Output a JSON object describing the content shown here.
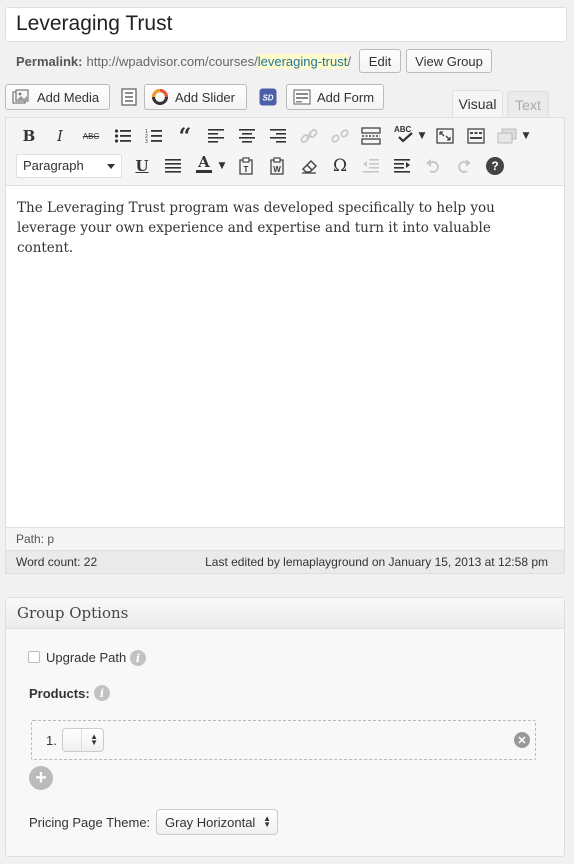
{
  "post": {
    "title": "Leveraging Trust",
    "permalink_label": "Permalink:",
    "permalink_base": "http://wpadvisor.com/courses/",
    "permalink_slug": "leveraging-trust",
    "permalink_trail": "/",
    "edit_label": "Edit",
    "view_group_label": "View Group"
  },
  "media_buttons": {
    "add_media": "Add Media",
    "add_slider": "Add Slider",
    "add_form": "Add Form"
  },
  "tabs": {
    "visual": "Visual",
    "text": "Text"
  },
  "toolbar": {
    "format_value": "Paragraph",
    "bold": "B",
    "italic": "I",
    "strike": "ABC",
    "quote": "“",
    "underline": "U",
    "text_color": "A",
    "omega": "Ω",
    "help": "?"
  },
  "editor": {
    "content": "The Leveraging Trust program was developed specifically to help you leverage your own experience and expertise and turn it into valuable content.",
    "path": "Path: p",
    "word_count": "Word count: 22",
    "last_edited": "Last edited by lemaplayground on January 15, 2013 at 12:58 pm"
  },
  "group_options": {
    "title": "Group Options",
    "upgrade_path_label": "Upgrade Path",
    "products_label": "Products:",
    "product_index": "1.",
    "pricing_label": "Pricing Page Theme:",
    "pricing_value": "Gray Horizontal"
  },
  "colors": {
    "slug_highlight": "#fffbcc",
    "link": "#21759b"
  }
}
